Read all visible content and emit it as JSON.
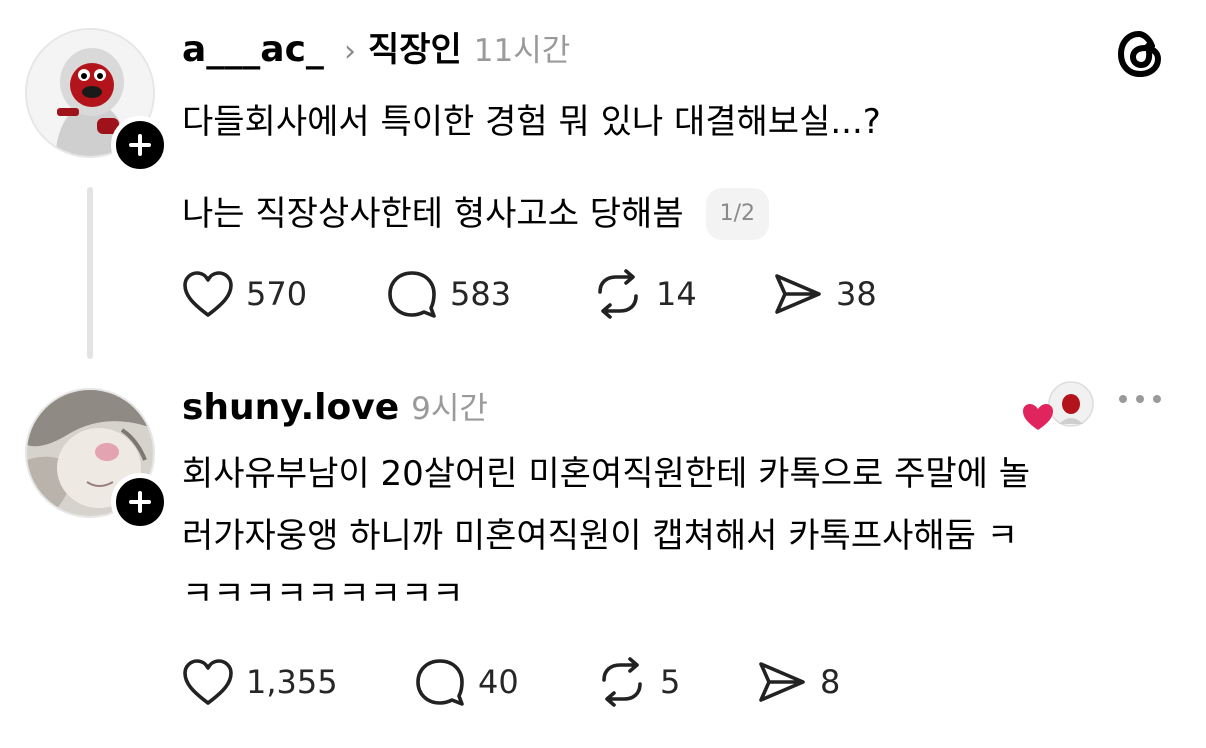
{
  "post": {
    "username": "a___ac_",
    "separator": "›",
    "topic": "직장인",
    "time": "11시간",
    "text_line1": "다들회사에서 특이한 경험 뭐 있나 대결해보실...?",
    "text_line2": "나는 직장상사한테 형사고소 당해봄",
    "page_indicator": "1/2",
    "likes": "570",
    "replies": "583",
    "reposts": "14",
    "shares": "38"
  },
  "reply": {
    "username": "shuny.love",
    "time": "9시간",
    "text_line1": "회사유부남이 20살어린 미혼여직원한테 카톡으로 주말에 놀",
    "text_line2": "러가자웅앵 하니까 미혼여직원이 캡쳐해서 카톡프사해둠 ㅋ",
    "text_line3": "ㅋㅋㅋㅋㅋㅋㅋㅋㅋ",
    "likes": "1,355",
    "replies": "40",
    "reposts": "5",
    "shares": "8"
  },
  "icons": {
    "app_logo": "threads-logo-icon",
    "follow": "plus-icon",
    "like": "heart-icon",
    "reply": "comment-icon",
    "repost": "repost-icon",
    "share": "send-icon",
    "more": "more-icon",
    "liked_by_author": "liked-by-author-icon"
  },
  "colors": {
    "text": "#000000",
    "muted": "#9a9a9a",
    "heart_red": "#e0245e"
  }
}
